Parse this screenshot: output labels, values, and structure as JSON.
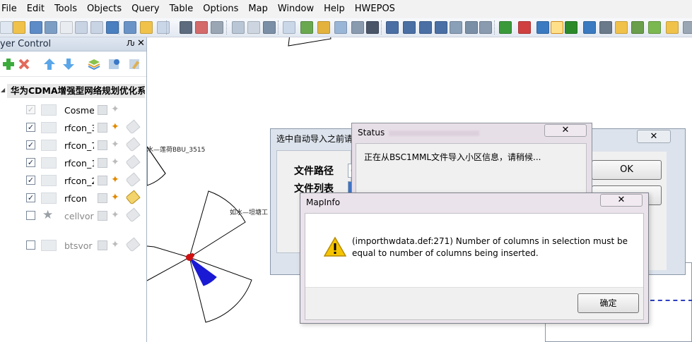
{
  "menu": [
    "File",
    "Edit",
    "Tools",
    "Objects",
    "Query",
    "Table",
    "Options",
    "Map",
    "Window",
    "Help",
    "HWEPOS"
  ],
  "layer_control": {
    "title": "yer Control",
    "pin": "Ԉ",
    "close": "✕",
    "root": "华为CDMA增强型网络规划优化系统",
    "layers": [
      {
        "name": "Cosmet",
        "checked": true,
        "disabled": true
      },
      {
        "name": "rfcon_3",
        "checked": true
      },
      {
        "name": "rfcon_7",
        "checked": true
      },
      {
        "name": "rfcon_1",
        "checked": true
      },
      {
        "name": "rfcon_2",
        "checked": true
      },
      {
        "name": "rfcon",
        "checked": true
      },
      {
        "name": "cellvor",
        "checked": false
      },
      {
        "name": "btsvor",
        "checked": false
      }
    ]
  },
  "map": {
    "labels": [
      "水—莲荷BBU_3515",
      "如水—坦塘工"
    ]
  },
  "import_dialog": {
    "title": "选中自动导入之前请",
    "path_label": "文件路径",
    "path_value": "C",
    "list_label": "文件列表",
    "list_value": "B",
    "ok": "OK",
    "close": "✕"
  },
  "status_dialog": {
    "title": "Status",
    "message": "正在从BSC1MML文件导入小区信息，请稍候...",
    "close": "✕"
  },
  "mapinfo_dialog": {
    "title": "MapInfo",
    "message_line1": "(importhwdata.def:271) Number of columns in selection must be",
    "message_line2": "equal to number of columns being inserted.",
    "confirm": "确定",
    "close": "✕"
  }
}
